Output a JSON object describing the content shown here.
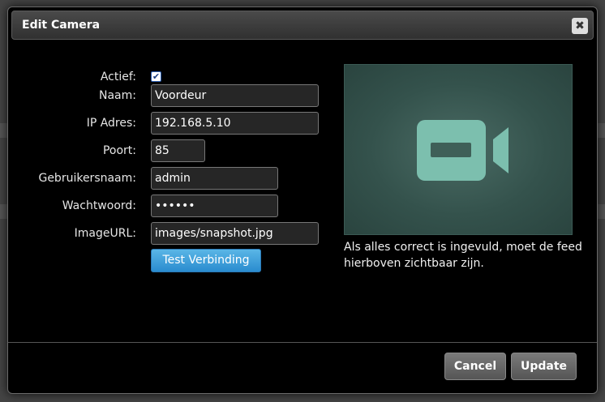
{
  "dialog": {
    "title": "Edit Camera",
    "close_icon": "close-icon"
  },
  "form": {
    "actief_label": "Actief:",
    "actief_checked": true,
    "naam_label": "Naam:",
    "naam_value": "Voordeur",
    "ip_label": "IP Adres:",
    "ip_value": "192.168.5.10",
    "poort_label": "Poort:",
    "poort_value": "85",
    "gebruiker_label": "Gebruikersnaam:",
    "gebruiker_value": "admin",
    "wachtwoord_label": "Wachtwoord:",
    "wachtwoord_value": "••••••",
    "imageurl_label": "ImageURL:",
    "imageurl_value": "images/snapshot.jpg",
    "test_button": "Test Verbinding"
  },
  "preview": {
    "icon": "video-camera-icon",
    "hint": "Als alles correct is ingevuld, moet de feed hierboven zichtbaar zijn."
  },
  "footer": {
    "cancel_label": "Cancel",
    "update_label": "Update"
  },
  "colors": {
    "accent_button": "#3a9ad8",
    "preview_bg": "#3f5f58",
    "preview_icon": "#7cbfae"
  }
}
